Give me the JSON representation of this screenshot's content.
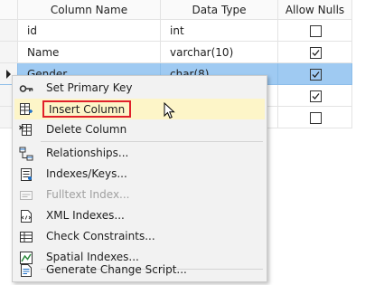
{
  "grid": {
    "headers": [
      "Column Name",
      "Data Type",
      "Allow Nulls"
    ],
    "rows": [
      {
        "name": "id",
        "type": "int",
        "allow_nulls": false
      },
      {
        "name": "Name",
        "type": "varchar(10)",
        "allow_nulls": true
      },
      {
        "name": "Gender",
        "type": "char(8)",
        "allow_nulls": true
      },
      {
        "name": "",
        "type": "",
        "allow_nulls": true
      },
      {
        "name": "",
        "type": "",
        "allow_nulls": false
      }
    ],
    "selection_color": "#9fcaf2"
  },
  "context_menu": {
    "items": [
      {
        "label": "Set Primary Key",
        "icon": "key-icon",
        "enabled": true
      },
      {
        "label": "Insert Column",
        "icon": "insert-column-icon",
        "enabled": true,
        "highlighted": true
      },
      {
        "label": "Delete Column",
        "icon": "delete-column-icon",
        "enabled": true
      },
      {
        "label": "Relationships...",
        "icon": "relationships-icon",
        "enabled": true
      },
      {
        "label": "Indexes/Keys...",
        "icon": "indexes-icon",
        "enabled": true
      },
      {
        "label": "Fulltext Index...",
        "icon": "fulltext-icon",
        "enabled": false
      },
      {
        "label": "XML Indexes...",
        "icon": "xml-indexes-icon",
        "enabled": true
      },
      {
        "label": "Check Constraints...",
        "icon": "check-constraints-icon",
        "enabled": true
      },
      {
        "label": "Spatial Indexes...",
        "icon": "spatial-indexes-icon",
        "enabled": true
      },
      {
        "label": "Generate Change Script...",
        "icon": "change-script-icon",
        "enabled": true
      }
    ],
    "highlight_border_color": "#e0202a",
    "hover_color": "#fdf5c8"
  }
}
